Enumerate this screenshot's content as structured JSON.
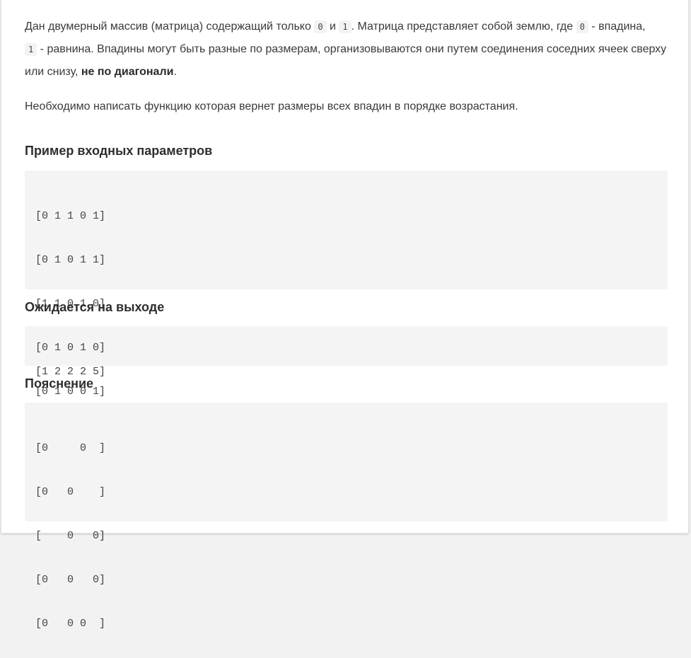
{
  "problem": {
    "para1": {
      "t1": "Дан двумерный массив (матрица) содержащий только ",
      "code_zero": "0",
      "t2": " и ",
      "code_one": "1",
      "t3": ". Матрица представляет собой землю, где ",
      "code_zero_b": "0",
      "t4": " - впадина,",
      "code_one_b": "1",
      "t5": " - равнина. Впадины могут быть разные по размерам, организовываются они путем соединения соседних ячеек сверху или снизу, ",
      "bold": "не по диагонали",
      "t6": "."
    },
    "para2": "Необходимо написать функцию которая вернет размеры всех впадин в порядке возрастания."
  },
  "example": {
    "heading": "Пример входных параметров",
    "lines": [
      "[0 1 1 0 1]",
      "[0 1 0 1 1]",
      "[1 1 0 1 0]",
      "[0 1 0 1 0]",
      "[0 1 0 0 1]"
    ]
  },
  "output": {
    "heading": "Ожидается на выходе",
    "lines": [
      "[1 2 2 2 5]"
    ]
  },
  "explanation": {
    "heading": "Пояснение",
    "lines": [
      "[0     0  ]",
      "[0   0    ]",
      "[    0   0]",
      "[0   0   0]",
      "[0   0 0  ]"
    ]
  }
}
